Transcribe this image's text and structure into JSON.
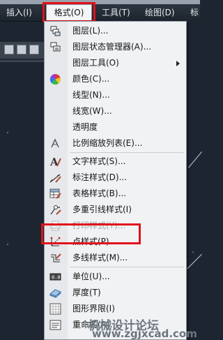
{
  "menubar": {
    "items": [
      {
        "label": "插入(I)"
      },
      {
        "label": "格式(O)"
      },
      {
        "label": "工具(T)"
      },
      {
        "label": "绘图(D)"
      },
      {
        "label": "标"
      }
    ]
  },
  "format_menu": {
    "items": [
      {
        "label": "图层(L)...",
        "icon": "layers-icon"
      },
      {
        "label": "图层状态管理器(A)...",
        "icon": "layer-states-icon"
      },
      {
        "label": "图层工具(O)",
        "icon": "none"
      },
      {
        "label": "颜色(C)...",
        "icon": "color-wheel-icon"
      },
      {
        "label": "线型(N)...",
        "icon": "none"
      },
      {
        "label": "线宽(W)...",
        "icon": "none"
      },
      {
        "label": "透明度",
        "icon": "none"
      },
      {
        "label": "比例缩放列表(E)...",
        "icon": "scale-list-icon"
      },
      {
        "label": "文字样式(S)...",
        "icon": "text-style-icon"
      },
      {
        "label": "标注样式(D)...",
        "icon": "dimension-style-icon"
      },
      {
        "label": "表格样式(B)...",
        "icon": "table-style-icon"
      },
      {
        "label": "多重引线样式(I)",
        "icon": "multileader-style-icon"
      },
      {
        "label": "打印样式(Y)...",
        "icon": "plot-style-icon"
      },
      {
        "label": "点样式(P)...",
        "icon": "point-style-icon"
      },
      {
        "label": "多线样式(M)...",
        "icon": "multiline-style-icon"
      },
      {
        "label": "单位(U)...",
        "icon": "units-icon"
      },
      {
        "label": "厚度(T)",
        "icon": "thickness-icon"
      },
      {
        "label": "图形界限(I)",
        "icon": "drawing-limits-icon"
      },
      {
        "label": "重命名(R)...",
        "icon": "rename-icon"
      }
    ]
  },
  "watermark": {
    "text": "机械设计论坛",
    "url": "www.zgjxcad.com"
  }
}
